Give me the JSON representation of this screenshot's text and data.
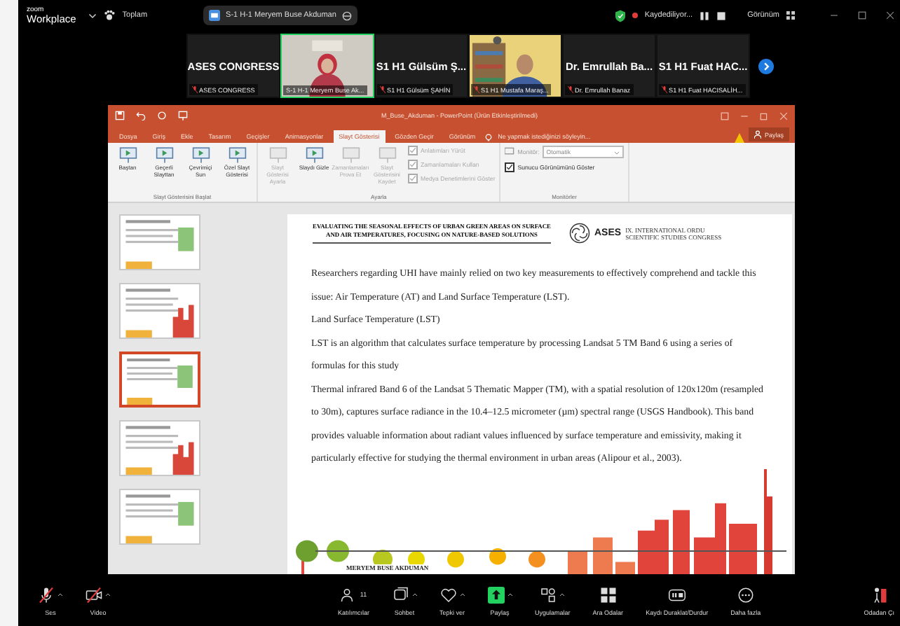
{
  "topbar": {
    "app_name": "zoom",
    "app_subtitle": "Workplace",
    "summary_label": "Toplam",
    "meeting_title": "S-1 H-1 Meryem Buse Akduman",
    "recording_label": "Kaydediliyor...",
    "view_label": "Görünüm"
  },
  "participants": [
    {
      "kind": "name",
      "title": "ASES CONGRESS",
      "name": "ASES CONGRESS",
      "muted": true,
      "speaking": false
    },
    {
      "kind": "video",
      "name": "S-1 H-1 Meryem Buse Ak...",
      "muted": false,
      "speaking": true
    },
    {
      "kind": "name",
      "title": "S1 H1 Gülsüm Ş...",
      "name": "S1 H1 Gülsüm ŞAHİN",
      "muted": true,
      "speaking": false
    },
    {
      "kind": "video",
      "name": "S1 H1 Mustafa Maraş...",
      "muted": true,
      "speaking": false
    },
    {
      "kind": "name",
      "title": "Dr. Emrullah Ba...",
      "name": "Dr. Emrullah Banaz",
      "muted": true,
      "speaking": false
    },
    {
      "kind": "name",
      "title": "S1 H1 Fuat HAC...",
      "name": "S1 H1 Fuat HACISALİH...",
      "muted": true,
      "speaking": false
    }
  ],
  "powerpoint": {
    "title": "M_Buse_Akduman - PowerPoint (Ürün Etkinleştirilmedi)",
    "tabs": [
      {
        "label": "Dosya",
        "selected": false
      },
      {
        "label": "Giriş",
        "selected": false
      },
      {
        "label": "Ekle",
        "selected": false
      },
      {
        "label": "Tasarım",
        "selected": false
      },
      {
        "label": "Geçişler",
        "selected": false
      },
      {
        "label": "Animasyonlar",
        "selected": false
      },
      {
        "label": "Slayt Gösterisi",
        "selected": true
      },
      {
        "label": "Gözden Geçir",
        "selected": false
      },
      {
        "label": "Görünüm",
        "selected": false
      }
    ],
    "tell_me": "Ne yapmak istediğinizi söyleyin...",
    "share_label": "Paylaş",
    "groups": [
      {
        "label": "Slayt Gösterisini Başlat",
        "items": [
          {
            "kind": "button",
            "label": "Baştan",
            "disabled": false
          },
          {
            "kind": "button",
            "label": "Geçerli Slayttan",
            "disabled": false
          },
          {
            "kind": "button",
            "label": "Çevrimiçi Sun",
            "disabled": false
          },
          {
            "kind": "button",
            "label": "Özel Slayt Gösterisi",
            "disabled": false
          }
        ]
      },
      {
        "label": "Ayarla",
        "items": [
          {
            "kind": "button",
            "label": "Slayt Gösterisi Ayarla",
            "disabled": true
          },
          {
            "kind": "button",
            "label": "Slaydı Gizle",
            "disabled": false
          },
          {
            "kind": "button",
            "label": "Zamanlamaları Prova Et",
            "disabled": true
          },
          {
            "kind": "button",
            "label": "Slayt Gösterisini Kaydet",
            "disabled": true
          },
          {
            "kind": "checks",
            "checks": [
              {
                "label": "Anlatımları Yürüt",
                "checked": true,
                "disabled": true
              },
              {
                "label": "Zamanlamaları Kullan",
                "checked": true,
                "disabled": true
              },
              {
                "label": "Medya Denetimlerini Göster",
                "checked": true,
                "disabled": true
              }
            ]
          }
        ]
      },
      {
        "label": "Monitörler",
        "items": [
          {
            "kind": "monitor",
            "label": "Monitör:",
            "value": "Otomatik",
            "check": {
              "label": "Sunucu Görünümünü Göster",
              "checked": true,
              "disabled": false
            }
          }
        ]
      }
    ],
    "thumbnails": [
      {
        "selected": false
      },
      {
        "selected": false
      },
      {
        "selected": true
      },
      {
        "selected": false
      },
      {
        "selected": false
      }
    ],
    "slide": {
      "header_title": "EVALUATING THE SEASONAL EFFECTS OF URBAN GREEN AREAS ON SURFACE AND AIR TEMPERATURES, FOCUSING ON NATURE-BASED SOLUTIONS",
      "logo_text": "ASES",
      "congress_text": "IX. INTERNATIONAL ORDU SCIENTIFIC STUDIES CONGRESS",
      "paragraphs": [
        "Researchers regarding UHI have mainly relied on two key measurements to effectively comprehend and tackle this issue: Air Temperature (AT) and Land Surface Temperature (LST).",
        "Land Surface Temperature (LST)",
        "LST is an algorithm that calculates surface temperature by processing Landsat 5 TM Band 6 using a series of formulas for this study",
        "Thermal infrared Band 6 of the Landsat 5 Thematic Mapper (TM), with a spatial resolution of 120x120m (resampled to 30m), captures surface radiance in the 10.4–12.5 micrometer (µm) spectral range (USGS Handbook). This band provides valuable information about radiant values influenced by surface temperature and emissivity, making it particularly effective for studying the thermal environment in urban areas (Alipour et al., 2003)."
      ],
      "author": "MERYEM BUSE AKDUMAN"
    }
  },
  "toolbar": [
    {
      "kind": "mic",
      "label": "Ses",
      "off": true,
      "caret": true
    },
    {
      "kind": "video",
      "label": "Video",
      "off": true,
      "caret": true
    },
    {
      "kind": "participants",
      "label": "Katılımcılar",
      "count": "11",
      "off": false,
      "caret": false
    },
    {
      "kind": "chat",
      "label": "Sohbet",
      "off": false,
      "caret": true
    },
    {
      "kind": "react",
      "label": "Tepki ver",
      "off": false,
      "caret": true
    },
    {
      "kind": "share",
      "label": "Paylaş",
      "off": false,
      "caret": true
    },
    {
      "kind": "apps",
      "label": "Uygulamalar",
      "off": false,
      "caret": true
    },
    {
      "kind": "rooms",
      "label": "Ara Odalar",
      "off": false,
      "caret": false
    },
    {
      "kind": "record",
      "label": "Kaydı Duraklat/Durdur",
      "off": false,
      "caret": false
    },
    {
      "kind": "more",
      "label": "Daha fazla",
      "off": false,
      "caret": false
    }
  ],
  "leave_label": "Odadan Çı"
}
